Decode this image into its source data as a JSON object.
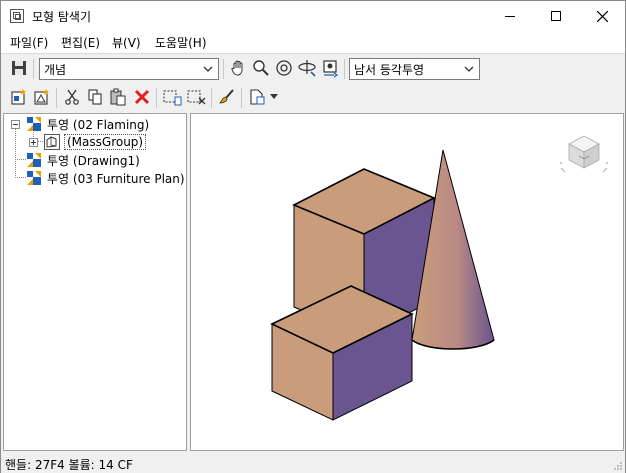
{
  "window": {
    "title": "모형 탐색기"
  },
  "menu": [
    {
      "label": "파일(F)"
    },
    {
      "label": "편집(E)"
    },
    {
      "label": "뷰(V)"
    },
    {
      "label": "도움말(H)"
    }
  ],
  "toolbar1": {
    "style_combo": {
      "value": "개념"
    },
    "view_combo": {
      "value": "남서 등각투영"
    }
  },
  "tree": {
    "items": [
      {
        "label": "투영 (02 Flaming)",
        "expanded": true
      },
      {
        "label": "(MassGroup)",
        "expanded": false
      },
      {
        "label": "투영 (Drawing1)"
      },
      {
        "label": "투영 (03 Furniture Plan)"
      }
    ]
  },
  "statusbar": {
    "text": "핸들: 27F4  볼륨: 14 CF"
  },
  "colors": {
    "face_top": "#c99d7b",
    "face_side": "#6a5590",
    "accent_blue": "#1f5fb6",
    "delete_red": "#e02020"
  }
}
